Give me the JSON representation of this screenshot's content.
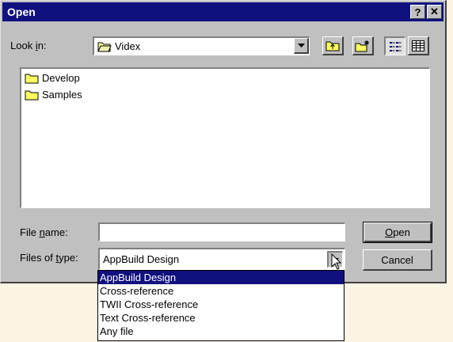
{
  "window": {
    "title": "Open",
    "help_glyph": "?",
    "close_glyph": "✕"
  },
  "lookin": {
    "label": "Look in:",
    "value": "Videx"
  },
  "toolbar": {
    "icons": [
      "up-one-level-icon",
      "create-new-folder-icon",
      "list-view-icon",
      "details-view-icon"
    ]
  },
  "files": [
    {
      "name": "Develop",
      "icon": "folder-icon"
    },
    {
      "name": "Samples",
      "icon": "folder-icon"
    }
  ],
  "filename": {
    "label": "File name:",
    "value": ""
  },
  "filetype": {
    "label": "Files of type:",
    "value": "AppBuild Design"
  },
  "buttons": {
    "open": "Open",
    "cancel": "Cancel"
  },
  "filetype_options": [
    "AppBuild Design",
    "Cross-reference",
    "TWII Cross-reference",
    "Text Cross-reference",
    "Any file"
  ],
  "colors": {
    "titlebar": "#10107f",
    "selection": "#10107f",
    "face": "#c0c0c0"
  }
}
